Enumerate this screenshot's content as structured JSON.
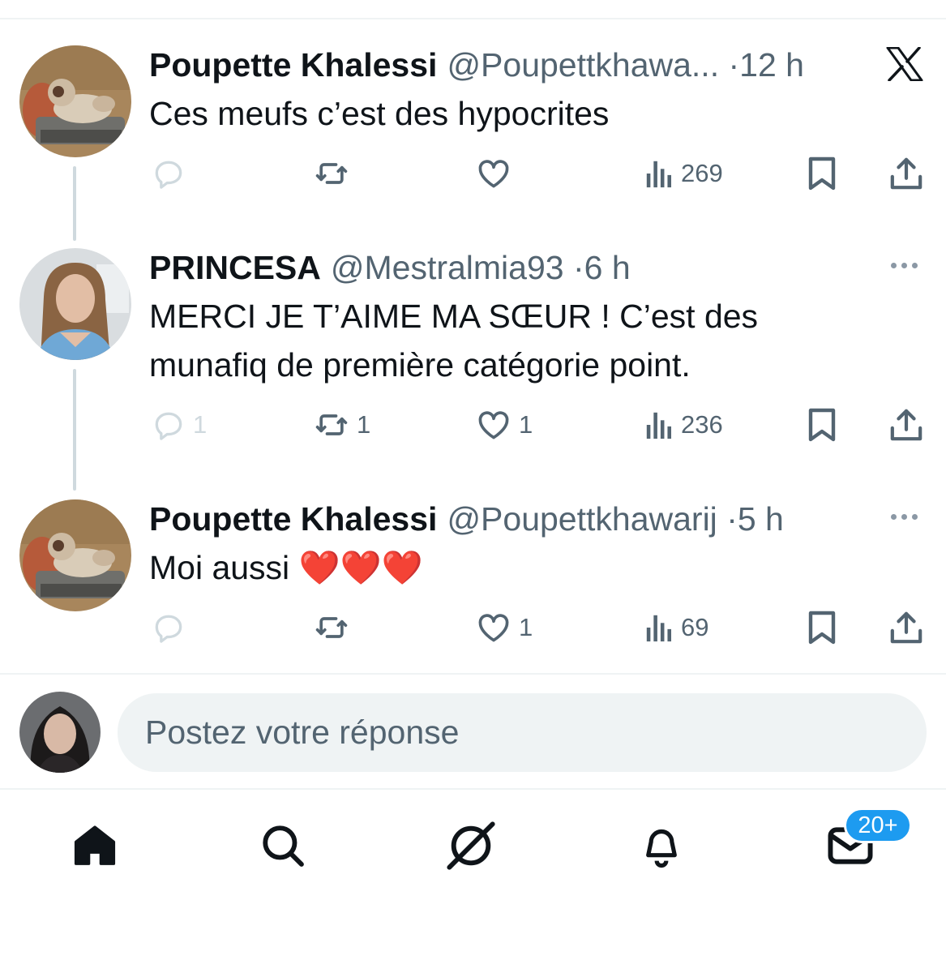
{
  "tweets": [
    {
      "name": "Poupette Khalessi",
      "handle": "@Poupettkhawa...",
      "time": "12 h",
      "text_lines": [
        "Ces meufs c’est des hypocrites"
      ],
      "corner_icon": "x-logo-icon",
      "stats": {
        "replies": "",
        "reposts": "",
        "likes": "",
        "views": "269"
      }
    },
    {
      "name": "PRINCESA",
      "handle": "@Mestralmia93",
      "time": "6 h",
      "text_lines": [
        "MERCI JE T’AIME MA SŒUR ! C’est des",
        "munafiq de première catégorie point."
      ],
      "corner_icon": "more-options-icon",
      "stats": {
        "replies": "1",
        "reposts": "1",
        "likes": "1",
        "views": "236"
      }
    },
    {
      "name": "Poupette Khalessi",
      "handle": "@Poupettkhawarij",
      "time": "5 h",
      "text_lines": [
        "Moi aussi ❤️❤️❤️"
      ],
      "corner_icon": "more-options-icon",
      "stats": {
        "replies": "",
        "reposts": "",
        "likes": "1",
        "views": "69"
      }
    }
  ],
  "separator": "·",
  "composer": {
    "placeholder": "Postez votre réponse"
  },
  "bottom_nav": {
    "items": [
      "home-icon",
      "search-icon",
      "grok-icon",
      "notifications-bell-icon",
      "messages-envelope-icon"
    ],
    "messages_badge": "20+"
  },
  "colors": {
    "text_primary": "#0f1419",
    "text_secondary": "#536471",
    "thread_line": "#cfd9de",
    "divider": "#eff3f4",
    "badge": "#1d9bf0"
  }
}
